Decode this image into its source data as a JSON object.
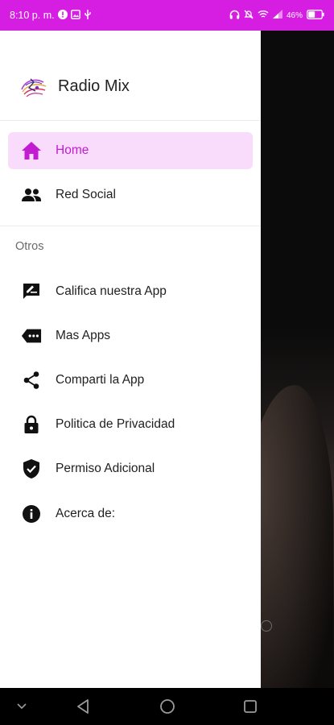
{
  "status_bar": {
    "time": "8:10 p. m.",
    "battery": "46%"
  },
  "app": {
    "title": "Radio Mix"
  },
  "menu": {
    "primary": [
      {
        "label": "Home",
        "icon": "home-icon",
        "active": true
      },
      {
        "label": "Red Social",
        "icon": "people-icon",
        "active": false
      }
    ],
    "section_title": "Otros",
    "secondary": [
      {
        "label": "Califica nuestra App",
        "icon": "rate-review-icon"
      },
      {
        "label": "Mas Apps",
        "icon": "more-apps-icon"
      },
      {
        "label": "Comparti la App",
        "icon": "share-icon"
      },
      {
        "label": "Politica de Privacidad",
        "icon": "lock-icon"
      },
      {
        "label": "Permiso Adicional",
        "icon": "verified-shield-icon"
      },
      {
        "label": "Acerca de:",
        "icon": "info-icon"
      }
    ]
  },
  "colors": {
    "accent": "#d61ee3",
    "active_bg": "#f9dcfb",
    "active_text": "#c21bd1"
  }
}
